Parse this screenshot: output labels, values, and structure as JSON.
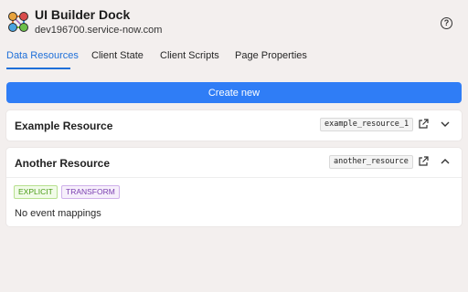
{
  "header": {
    "title": "UI Builder Dock",
    "subtitle": "dev196700.service-now.com",
    "help_label": "?"
  },
  "tabs": [
    {
      "label": "Data Resources",
      "active": true
    },
    {
      "label": "Client State",
      "active": false
    },
    {
      "label": "Client Scripts",
      "active": false
    },
    {
      "label": "Page Properties",
      "active": false
    }
  ],
  "create_button": {
    "label": "Create new"
  },
  "resources": [
    {
      "title": "Example Resource",
      "id": "example_resource_1",
      "expanded": false,
      "icons": [
        "open-external-icon",
        "chevron-down-icon"
      ]
    },
    {
      "title": "Another Resource",
      "id": "another_resource",
      "expanded": true,
      "icons": [
        "open-external-icon",
        "chevron-up-icon"
      ],
      "badges": [
        "EXPLICIT",
        "TRANSFORM"
      ],
      "empty_text": "No event mappings"
    }
  ],
  "colors": {
    "accent": "#2f7df6",
    "active_tab": "#1e6fd9",
    "background": "#f3efee",
    "explicit": "#4a9b16",
    "transform": "#7a3fb0"
  }
}
